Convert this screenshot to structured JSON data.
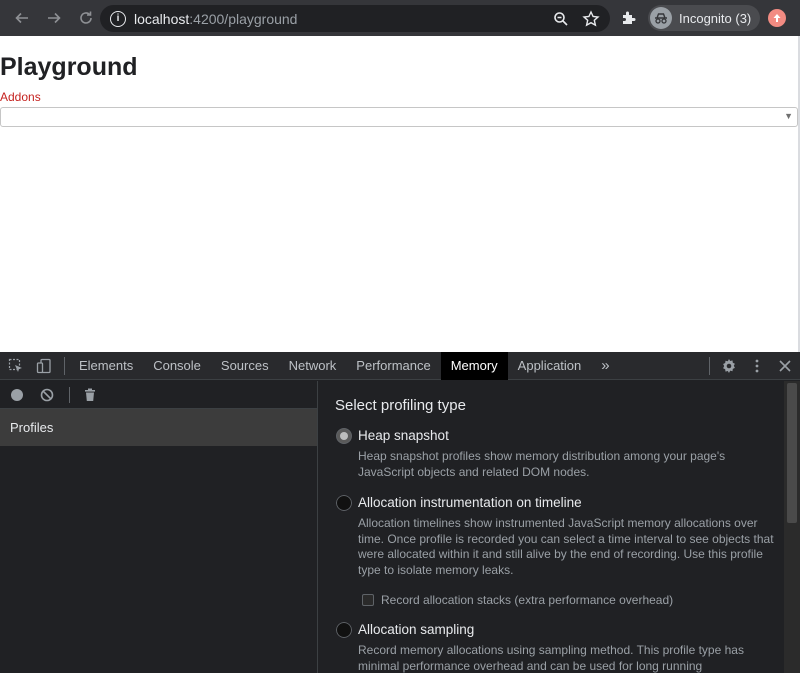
{
  "browser": {
    "url_host": "localhost",
    "url_path": ":4200/playground",
    "profile_label": "Incognito (3)"
  },
  "page": {
    "title": "Playground",
    "addons_label": "Addons",
    "addons_select_value": ""
  },
  "devtools": {
    "tabs": [
      "Elements",
      "Console",
      "Sources",
      "Network",
      "Performance",
      "Memory",
      "Application"
    ],
    "active_tab": "Memory",
    "more_tabs_glyph": "»",
    "sidebar": {
      "profiles_label": "Profiles"
    },
    "memory": {
      "section_title": "Select profiling type",
      "options": [
        {
          "title": "Heap snapshot",
          "description": "Heap snapshot profiles show memory distribution among your page's JavaScript objects and related DOM nodes.",
          "checked": true
        },
        {
          "title": "Allocation instrumentation on timeline",
          "description": "Allocation timelines show instrumented JavaScript memory allocations over time. Once profile is recorded you can select a time interval to see objects that were allocated within it and still alive by the end of recording. Use this profile type to isolate memory leaks.",
          "checked": false
        },
        {
          "title": "Allocation sampling",
          "description": "Record memory allocations using sampling method. This profile type has minimal performance overhead and can be used for long running",
          "checked": false
        }
      ],
      "record_stacks_label": "Record allocation stacks (extra performance overhead)"
    }
  }
}
